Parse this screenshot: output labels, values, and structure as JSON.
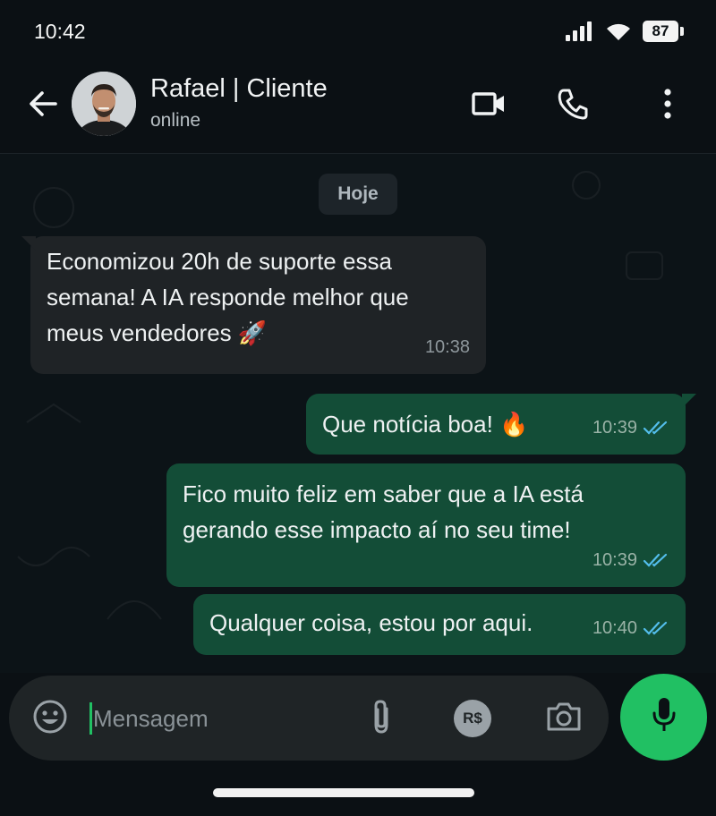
{
  "status_bar": {
    "time": "10:42",
    "battery": "87",
    "icons": [
      "signal-icon",
      "wifi-icon",
      "battery-icon"
    ]
  },
  "header": {
    "back_icon": "arrow-left-icon",
    "contact_name": "Rafael | Cliente",
    "contact_status": "online",
    "actions": [
      "video-call-icon",
      "phone-icon",
      "more-vert-icon"
    ]
  },
  "chat": {
    "date_chip": "Hoje",
    "messages": [
      {
        "direction": "incoming",
        "lines": [
          "Economizou 20h de suporte essa",
          "semana! A IA responde melhor que",
          "meus vendedores 🚀"
        ],
        "time": "10:38"
      },
      {
        "direction": "outgoing",
        "lines": [
          "Que notícia boa! 🔥"
        ],
        "time": "10:39",
        "read": true
      },
      {
        "direction": "outgoing",
        "lines": [
          "Fico muito feliz em saber que a IA está",
          "gerando esse impacto aí no seu time!"
        ],
        "time": "10:39",
        "read": true
      },
      {
        "direction": "outgoing",
        "lines": [
          "Qualquer coisa, estou por aqui."
        ],
        "time": "10:40",
        "read": true
      }
    ]
  },
  "composer": {
    "placeholder": "Mensagem",
    "value": "",
    "icons": [
      "emoji-icon",
      "attach-icon",
      "payment-icon",
      "camera-icon",
      "mic-icon"
    ],
    "payment_label": "R$"
  },
  "colors": {
    "accent": "#21c063",
    "outgoing_bubble": "#134d37",
    "incoming_bubble": "#1f2326",
    "read_ticks": "#53bdeb",
    "background": "#0b1014"
  }
}
